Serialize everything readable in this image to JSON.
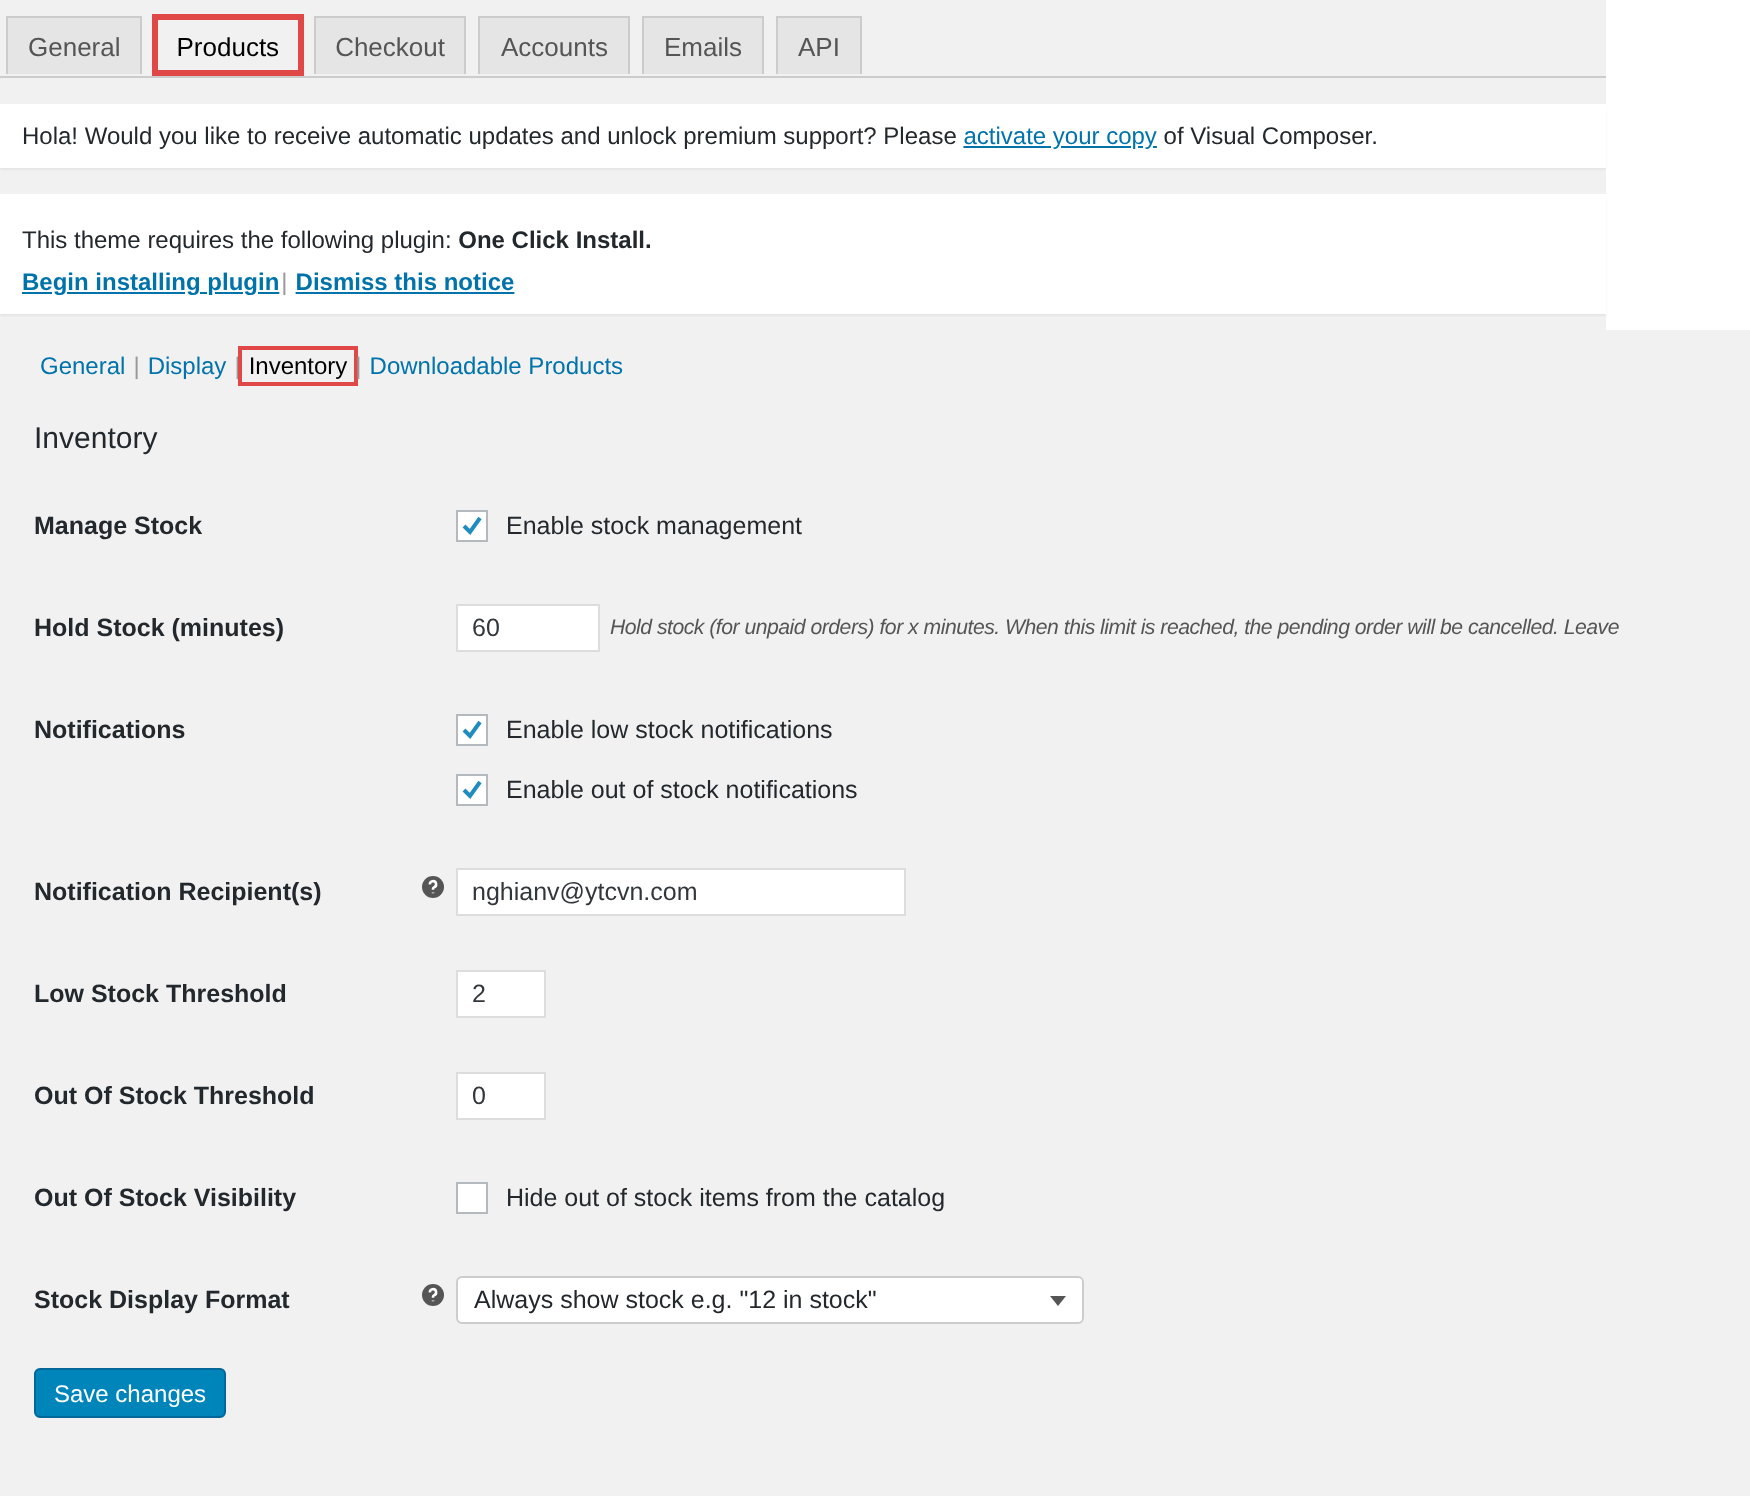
{
  "tabs": [
    {
      "label": "General",
      "selected": false
    },
    {
      "label": "Products",
      "selected": true
    },
    {
      "label": "Checkout",
      "selected": false
    },
    {
      "label": "Accounts",
      "selected": false
    },
    {
      "label": "Emails",
      "selected": false
    },
    {
      "label": "API",
      "selected": false
    }
  ],
  "update_notice": {
    "before": "Hola! Would you like to receive automatic updates and unlock premium support? Please",
    "link": "activate your copy",
    "after": "of Visual Composer."
  },
  "plugin_notice": {
    "text": "This theme requires the following plugin: **One Click Install.**",
    "links": [
      "Begin installing plugin",
      "Dismiss this notice"
    ],
    "separator": "|"
  },
  "subtabs": [
    {
      "label": "General",
      "selected": false
    },
    {
      "label": "Display",
      "selected": false
    },
    {
      "label": "Inventory",
      "selected": true
    },
    {
      "label": "Downloadable Products",
      "selected": false
    }
  ],
  "subtab_separator": "|",
  "section_title": "Inventory",
  "rows": [
    {
      "label": "Manage Stock",
      "kind": "checkbox",
      "help": false,
      "options": [
        {
          "label": "Enable stock management",
          "checked": true
        }
      ]
    },
    {
      "label": "Hold Stock (minutes)",
      "kind": "number",
      "help": false,
      "value": "60",
      "description": "Hold stock (for unpaid orders) for x minutes. When this limit is reached, the pending order will be cancelled. Leave"
    },
    {
      "label": "Notifications",
      "kind": "checkbox",
      "help": false,
      "options": [
        {
          "label": "Enable low stock notifications",
          "checked": true
        },
        {
          "label": "Enable out of stock notifications",
          "checked": true
        }
      ]
    },
    {
      "label": "Notification Recipient(s)",
      "kind": "email",
      "help": true,
      "value": "nghianv@ytcvn.com"
    },
    {
      "label": "Low Stock Threshold",
      "kind": "threshold",
      "help": false,
      "value": "2"
    },
    {
      "label": "Out Of Stock Threshold",
      "kind": "threshold",
      "help": false,
      "value": "0"
    },
    {
      "label": "Out Of Stock Visibility",
      "kind": "checkbox",
      "help": false,
      "options": [
        {
          "label": "Hide out of stock items from the catalog",
          "checked": false
        }
      ]
    },
    {
      "label": "Stock Display Format",
      "kind": "select",
      "help": true,
      "value": "Always show stock e.g. \"12 in stock\""
    }
  ],
  "save_button": "Save changes"
}
